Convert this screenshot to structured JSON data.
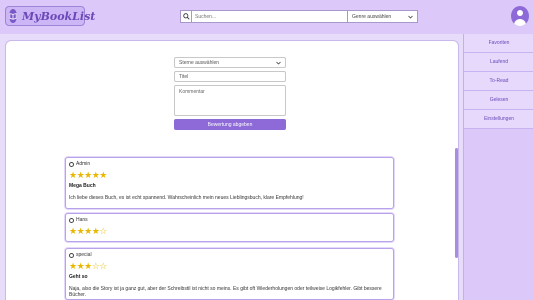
{
  "app": {
    "logo_text": "MyBookList",
    "logo_glyph": "📖"
  },
  "search": {
    "placeholder": "Suchen...",
    "value": ""
  },
  "genre_select": {
    "selected": "Genre auswählen"
  },
  "form": {
    "stars_select": "Sterne auswählen",
    "title_placeholder": "Titel",
    "comment_placeholder": "Kommentar",
    "submit_label": "Bewertung abgeben"
  },
  "reviews": [
    {
      "user": "Admin",
      "stars": "★★★★★",
      "title": "Mega Buch",
      "text": "Ich liebe dieses Buch, es ist echt spannend. Wahrscheinlich mein neues Lieblingsbuch, klare Empfehlung!"
    },
    {
      "user": "Hans",
      "stars": "★★★★☆",
      "title": "",
      "text": ""
    },
    {
      "user": "special",
      "stars": "★★★☆☆",
      "title": "Geht so",
      "text": "Naja, also die Story ist ja ganz gut, aber der Schreibstil ist nicht so meins. Es gibt oft Wiederholungen oder teilweise Logikfehler. Gibt bessere Bücher."
    }
  ],
  "nav": [
    "Favoriten",
    "Laufend",
    "To-Read",
    "Gelesen",
    "Einstellungen"
  ],
  "colors": {
    "accent": "#8e6ad8",
    "panel": "#dcc9fa",
    "star": "#e8b800"
  }
}
